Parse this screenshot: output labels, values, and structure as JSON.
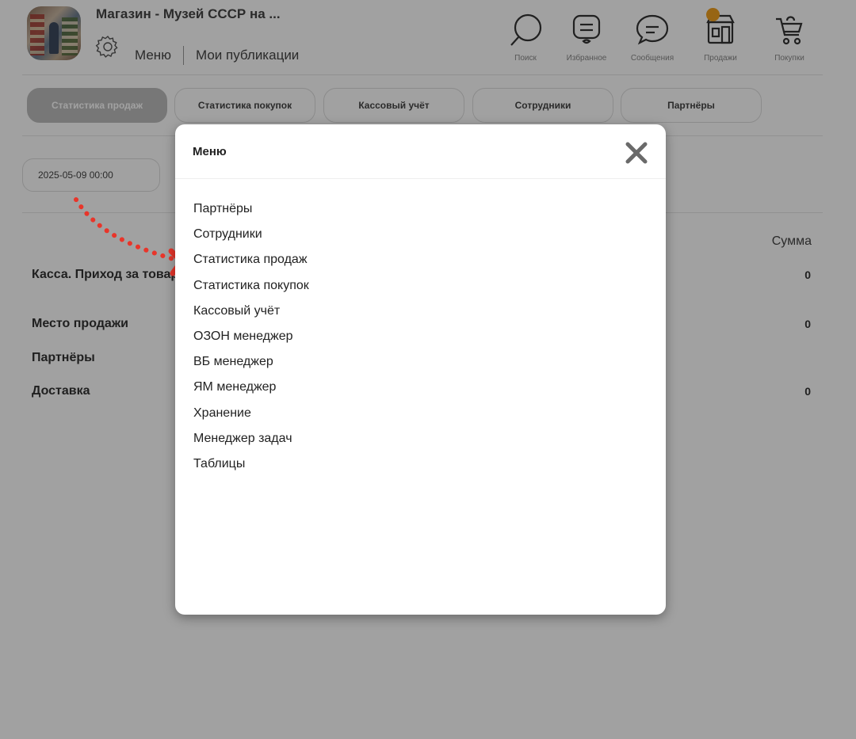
{
  "header": {
    "shop_title": "Магазин - Музей СССР на ...",
    "nav_menu": "Меню",
    "nav_publications": "Мои публикации",
    "icons": [
      {
        "name": "search-icon",
        "label": "Поиск"
      },
      {
        "name": "favorites-icon",
        "label": "Избранное"
      },
      {
        "name": "messages-icon",
        "label": "Сообщения"
      },
      {
        "name": "sales-icon",
        "label": "Продажи"
      },
      {
        "name": "purchases-icon",
        "label": "Покупки"
      }
    ],
    "notification_color": "#f0a020"
  },
  "tabs": [
    {
      "label": "Статистика продаж",
      "active": true
    },
    {
      "label": "Статистика покупок",
      "active": false
    },
    {
      "label": "Кассовый учёт",
      "active": false
    },
    {
      "label": "Сотрудники",
      "active": false
    },
    {
      "label": "Партнёры",
      "active": false
    }
  ],
  "date_filter": {
    "value": "2025-05-09 00:00"
  },
  "table": {
    "sum_header": "Сумма",
    "rows": [
      {
        "label": "Касса. Приход за товар",
        "value": "0"
      },
      {
        "label": "Место продажи",
        "value": "0"
      },
      {
        "label": "Партнёры",
        "value": ""
      },
      {
        "label": "Доставка",
        "value": "0"
      }
    ]
  },
  "modal": {
    "title": "Меню",
    "close_icon": "close-icon",
    "items": [
      "Партнёры",
      "Сотрудники",
      "Статистика продаж",
      "Статистика покупок",
      "Кассовый учёт",
      "ОЗОН менеджер",
      "ВБ менеджер",
      "ЯМ менеджер",
      "Хранение",
      "Менеджер задач",
      "Таблицы"
    ]
  },
  "annotation": {
    "arrow_color": "#e8352a"
  }
}
